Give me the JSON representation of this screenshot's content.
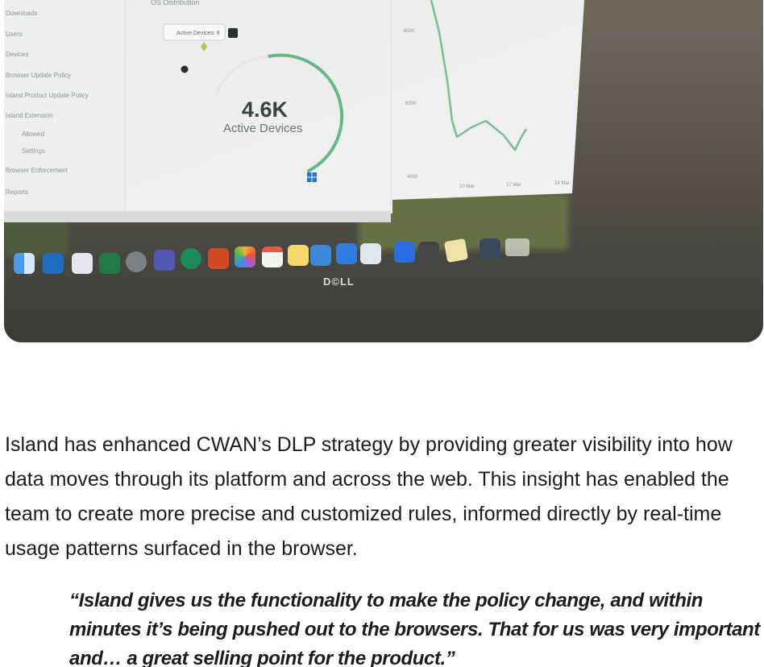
{
  "hero": {
    "screen": {
      "sidebar_items": [
        "Downloads",
        "Users",
        "Devices",
        "Browser Update Policy",
        "Island Product Update Policy",
        "Island Extension",
        "Allowed",
        "Settings",
        "Browser Enforcement",
        "Reports"
      ],
      "card_title": "OS Distribution",
      "tooltip": "Active Devices: 8",
      "gauge_value": "4.6K",
      "gauge_label": "Active Devices",
      "chart_y_ticks": [
        "8000",
        "6000",
        "4000"
      ],
      "chart_x_ticks": [
        "10 Mar",
        "17 Mar",
        "24 Mar"
      ]
    },
    "monitor_brand": "D©LL",
    "dock_icons": [
      "finder-icon",
      "outlook-icon",
      "launchpad-icon",
      "excel-icon",
      "settings-icon",
      "teams-icon",
      "sheets-icon",
      "powerpoint-icon",
      "photos-icon",
      "calendar-icon",
      "notes-icon",
      "remote-desktop-icon",
      "app-store-icon",
      "preview-icon",
      "zoom-icon",
      "calculator-icon",
      "stickies-icon",
      "screenshot-icon",
      "folder-icon"
    ]
  },
  "article": {
    "paragraph": "Island has enhanced CWAN’s DLP strategy by providing greater visibility into how data moves through its platform and across the web. This insight has enabled the team to create more precise and customized rules, informed directly by real-time usage patterns surfaced in the browser.",
    "quote": "“Island gives us the functionality to make the policy change, and within minutes it’s being pushed out to the browsers. That for us was very important and… a great selling point for the product.”"
  }
}
